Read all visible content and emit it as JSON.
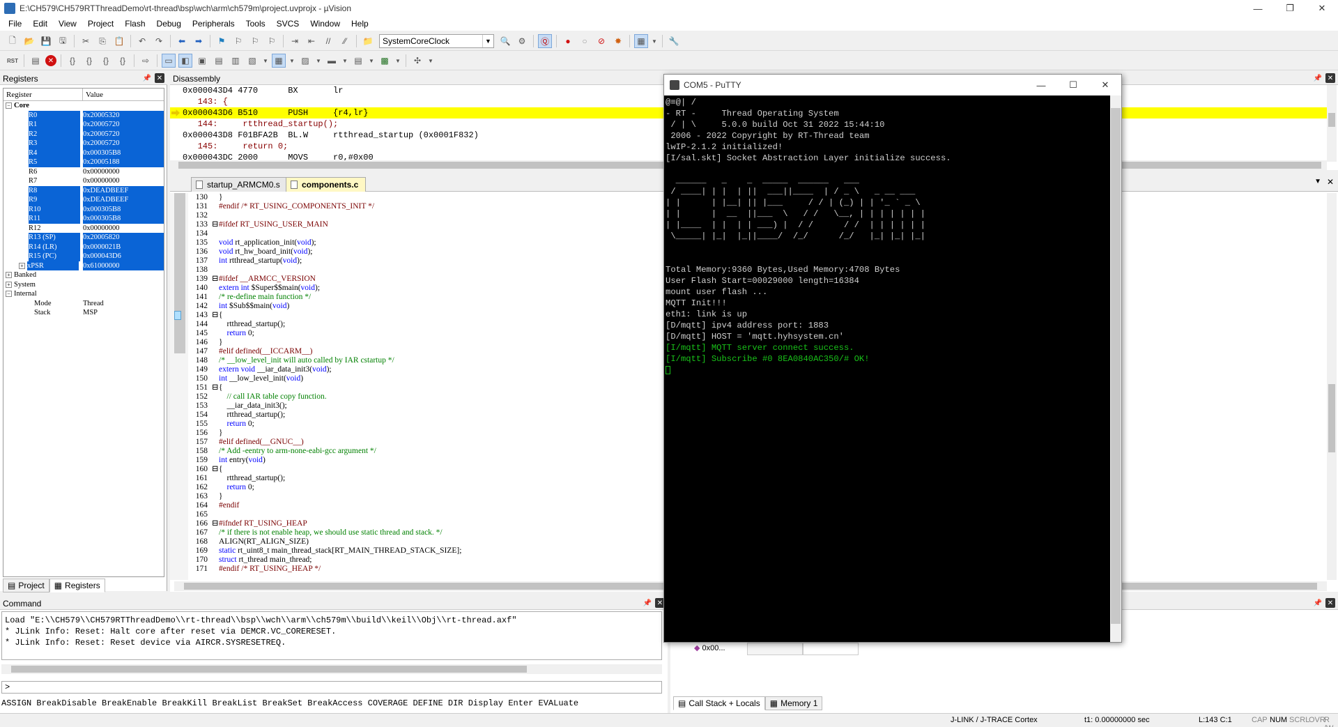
{
  "window": {
    "title": "E:\\CH579\\CH579RTThreadDemo\\rt-thread\\bsp\\wch\\arm\\ch579m\\project.uvprojx - µVision",
    "minimize": "—",
    "maximize": "❐",
    "close": "✕"
  },
  "menu": [
    "File",
    "Edit",
    "View",
    "Project",
    "Flash",
    "Debug",
    "Peripherals",
    "Tools",
    "SVCS",
    "Window",
    "Help"
  ],
  "toolbar": {
    "combo_value": "SystemCoreClock"
  },
  "registers": {
    "panel_title": "Registers",
    "col_register": "Register",
    "col_value": "Value",
    "core_label": "Core",
    "rows": [
      {
        "name": "R0",
        "value": "0x20005320",
        "selected": true
      },
      {
        "name": "R1",
        "value": "0x20005720",
        "selected": true
      },
      {
        "name": "R2",
        "value": "0x20005720",
        "selected": true
      },
      {
        "name": "R3",
        "value": "0x20005720",
        "selected": true
      },
      {
        "name": "R4",
        "value": "0x000305B8",
        "selected": true
      },
      {
        "name": "R5",
        "value": "0x20005188",
        "selected": true
      },
      {
        "name": "R6",
        "value": "0x00000000",
        "selected": false
      },
      {
        "name": "R7",
        "value": "0x00000000",
        "selected": false
      },
      {
        "name": "R8",
        "value": "0xDEADBEEF",
        "selected": true
      },
      {
        "name": "R9",
        "value": "0xDEADBEEF",
        "selected": true
      },
      {
        "name": "R10",
        "value": "0x000305B8",
        "selected": true
      },
      {
        "name": "R11",
        "value": "0x000305B8",
        "selected": true
      },
      {
        "name": "R12",
        "value": "0x00000000",
        "selected": false
      },
      {
        "name": "R13 (SP)",
        "value": "0x20005820",
        "selected": true
      },
      {
        "name": "R14 (LR)",
        "value": "0x0000021B",
        "selected": true
      },
      {
        "name": "R15 (PC)",
        "value": "0x000043D6",
        "selected": true
      },
      {
        "name": "xPSR",
        "value": "0x61000000",
        "selected": true
      }
    ],
    "groups": [
      "Banked",
      "System",
      "Internal"
    ],
    "internal": [
      {
        "name": "Mode",
        "value": "Thread"
      },
      {
        "name": "Stack",
        "value": "MSP"
      }
    ],
    "tab_project": "Project",
    "tab_registers": "Registers"
  },
  "disassembly": {
    "panel_title": "Disassembly",
    "lines": [
      {
        "text": "0x000043D4 4770      BX       lr",
        "type": "asm"
      },
      {
        "text": "   143: {",
        "type": "src"
      },
      {
        "text": "0x000043D6 B510      PUSH     {r4,lr}",
        "type": "current"
      },
      {
        "text": "   144:     rtthread_startup();",
        "type": "src"
      },
      {
        "text": "0x000043D8 F01BFA2B  BL.W     rtthread_startup (0x0001F832)",
        "type": "asm"
      },
      {
        "text": "   145:     return 0;",
        "type": "src"
      },
      {
        "text": "0x000043DC 2000      MOVS     r0,#0x00",
        "type": "asm"
      }
    ]
  },
  "editor": {
    "tabs": [
      {
        "label": "startup_ARMCM0.s",
        "active": false
      },
      {
        "label": "components.c",
        "active": true
      }
    ],
    "lines": [
      {
        "n": "130",
        "t": "}",
        "c": ""
      },
      {
        "n": "131",
        "t": "#endif /* RT_USING_COMPONENTS_INIT */",
        "c": "pp"
      },
      {
        "n": "132",
        "t": "",
        "c": ""
      },
      {
        "n": "133",
        "t": "#ifdef RT_USING_USER_MAIN",
        "c": "pp"
      },
      {
        "n": "134",
        "t": "",
        "c": ""
      },
      {
        "n": "135",
        "t": "void rt_application_init(void);",
        "c": ""
      },
      {
        "n": "136",
        "t": "void rt_hw_board_init(void);",
        "c": ""
      },
      {
        "n": "137",
        "t": "int rtthread_startup(void);",
        "c": ""
      },
      {
        "n": "138",
        "t": "",
        "c": ""
      },
      {
        "n": "139",
        "t": "#ifdef __ARMCC_VERSION",
        "c": "pp"
      },
      {
        "n": "140",
        "t": "extern int $Super$$main(void);",
        "c": ""
      },
      {
        "n": "141",
        "t": "/* re-define main function */",
        "c": "cm"
      },
      {
        "n": "142",
        "t": "int $Sub$$main(void)",
        "c": ""
      },
      {
        "n": "143",
        "t": "{",
        "c": ""
      },
      {
        "n": "144",
        "t": "    rtthread_startup();",
        "c": ""
      },
      {
        "n": "145",
        "t": "    return 0;",
        "c": ""
      },
      {
        "n": "146",
        "t": "}",
        "c": ""
      },
      {
        "n": "147",
        "t": "#elif defined(__ICCARM__)",
        "c": "pp"
      },
      {
        "n": "148",
        "t": "/* __low_level_init will auto called by IAR cstartup */",
        "c": "cm"
      },
      {
        "n": "149",
        "t": "extern void __iar_data_init3(void);",
        "c": ""
      },
      {
        "n": "150",
        "t": "int __low_level_init(void)",
        "c": ""
      },
      {
        "n": "151",
        "t": "{",
        "c": ""
      },
      {
        "n": "152",
        "t": "    // call IAR table copy function.",
        "c": "cm"
      },
      {
        "n": "153",
        "t": "    __iar_data_init3();",
        "c": ""
      },
      {
        "n": "154",
        "t": "    rtthread_startup();",
        "c": ""
      },
      {
        "n": "155",
        "t": "    return 0;",
        "c": ""
      },
      {
        "n": "156",
        "t": "}",
        "c": ""
      },
      {
        "n": "157",
        "t": "#elif defined(__GNUC__)",
        "c": "pp"
      },
      {
        "n": "158",
        "t": "/* Add -eentry to arm-none-eabi-gcc argument */",
        "c": "cm"
      },
      {
        "n": "159",
        "t": "int entry(void)",
        "c": ""
      },
      {
        "n": "160",
        "t": "{",
        "c": ""
      },
      {
        "n": "161",
        "t": "    rtthread_startup();",
        "c": ""
      },
      {
        "n": "162",
        "t": "    return 0;",
        "c": ""
      },
      {
        "n": "163",
        "t": "}",
        "c": ""
      },
      {
        "n": "164",
        "t": "#endif",
        "c": "pp"
      },
      {
        "n": "165",
        "t": "",
        "c": ""
      },
      {
        "n": "166",
        "t": "#ifndef RT_USING_HEAP",
        "c": "pp"
      },
      {
        "n": "167",
        "t": "/* if there is not enable heap, we should use static thread and stack. */",
        "c": "cm"
      },
      {
        "n": "168",
        "t": "ALIGN(RT_ALIGN_SIZE)",
        "c": ""
      },
      {
        "n": "169",
        "t": "static rt_uint8_t main_thread_stack[RT_MAIN_THREAD_STACK_SIZE];",
        "c": ""
      },
      {
        "n": "170",
        "t": "struct rt_thread main_thread;",
        "c": ""
      },
      {
        "n": "171",
        "t": "#endif /* RT_USING_HEAP */",
        "c": "pp"
      }
    ]
  },
  "command": {
    "panel_title": "Command",
    "lines": [
      "Load \"E:\\\\CH579\\\\CH579RTThreadDemo\\\\rt-thread\\\\bsp\\\\wch\\\\arm\\\\ch579m\\\\build\\\\keil\\\\Obj\\\\rt-thread.axf\"",
      "* JLink Info: Reset: Halt core after reset via DEMCR.VC_CORERESET.",
      "* JLink Info: Reset: Reset device via AIRCR.SYSRESETREQ."
    ],
    "prompt": ">",
    "hint": "ASSIGN BreakDisable BreakEnable BreakKill BreakList BreakSet BreakAccess COVERAGE DEFINE DIR Display Enter EVALuate"
  },
  "callstack": {
    "row_value": "0x00...",
    "tab_callstack": "Call Stack + Locals",
    "tab_memory": "Memory 1"
  },
  "putty": {
    "title": "COM5 - PuTTY",
    "minimize": "—",
    "maximize": "☐",
    "close": "✕",
    "lines": [
      {
        "t": "@≡@| /",
        "g": false
      },
      {
        "t": "- RT -     Thread Operating System",
        "g": false
      },
      {
        "t": " / | \\     5.0.0 build Oct 31 2022 15:44:10",
        "g": false
      },
      {
        "t": " 2006 - 2022 Copyright by RT-Thread team",
        "g": false
      },
      {
        "t": "lwIP-2.1.2 initialized!",
        "g": false
      },
      {
        "t": "[I/sal.skt] Socket Abstraction Layer initialize success.",
        "g": false
      },
      {
        "t": "",
        "g": false
      },
      {
        "t": "  ______   _    _  _____  ______   ___",
        "g": false
      },
      {
        "t": " / ____| | |  | ||  ___||____  | / _ \\   _ __ ___",
        "g": false
      },
      {
        "t": "| |      | |__| || |___     / / | (_) | | '_ ` _ \\",
        "g": false
      },
      {
        "t": "| |      |  __  ||___  \\   / /   \\__, | | | | | | |",
        "g": false
      },
      {
        "t": "| |____  | |  | | ___) |  / /      / /  | | | | | |",
        "g": false
      },
      {
        "t": " \\_____| |_|  |_||____/  /_/      /_/   |_| |_| |_|",
        "g": false
      },
      {
        "t": "",
        "g": false
      },
      {
        "t": "",
        "g": false
      },
      {
        "t": "Total Memory:9360 Bytes,Used Memory:4708 Bytes",
        "g": false
      },
      {
        "t": "User Flash Start=00029000 length=16384",
        "g": false
      },
      {
        "t": "mount user flash ...",
        "g": false
      },
      {
        "t": "MQTT Init!!!",
        "g": false
      },
      {
        "t": "eth1: link is up",
        "g": false
      },
      {
        "t": "[D/mqtt] ipv4 address port: 1883",
        "g": false
      },
      {
        "t": "[D/mqtt] HOST = 'mqtt.hyhsystem.cn'",
        "g": false
      },
      {
        "t": "[I/mqtt] MQTT server connect success.",
        "g": true
      },
      {
        "t": "[I/mqtt] Subscribe #0 8EA0840AC350/# OK!",
        "g": true
      }
    ]
  },
  "status": {
    "debugger": "J-LINK / J-TRACE Cortex",
    "time": "t1: 0.00000000 sec",
    "position": "L:143 C:1",
    "cap": "CAP",
    "num": "NUM",
    "scrl": "SCRL",
    "ovr": "OVR",
    "rw": "R /W"
  }
}
